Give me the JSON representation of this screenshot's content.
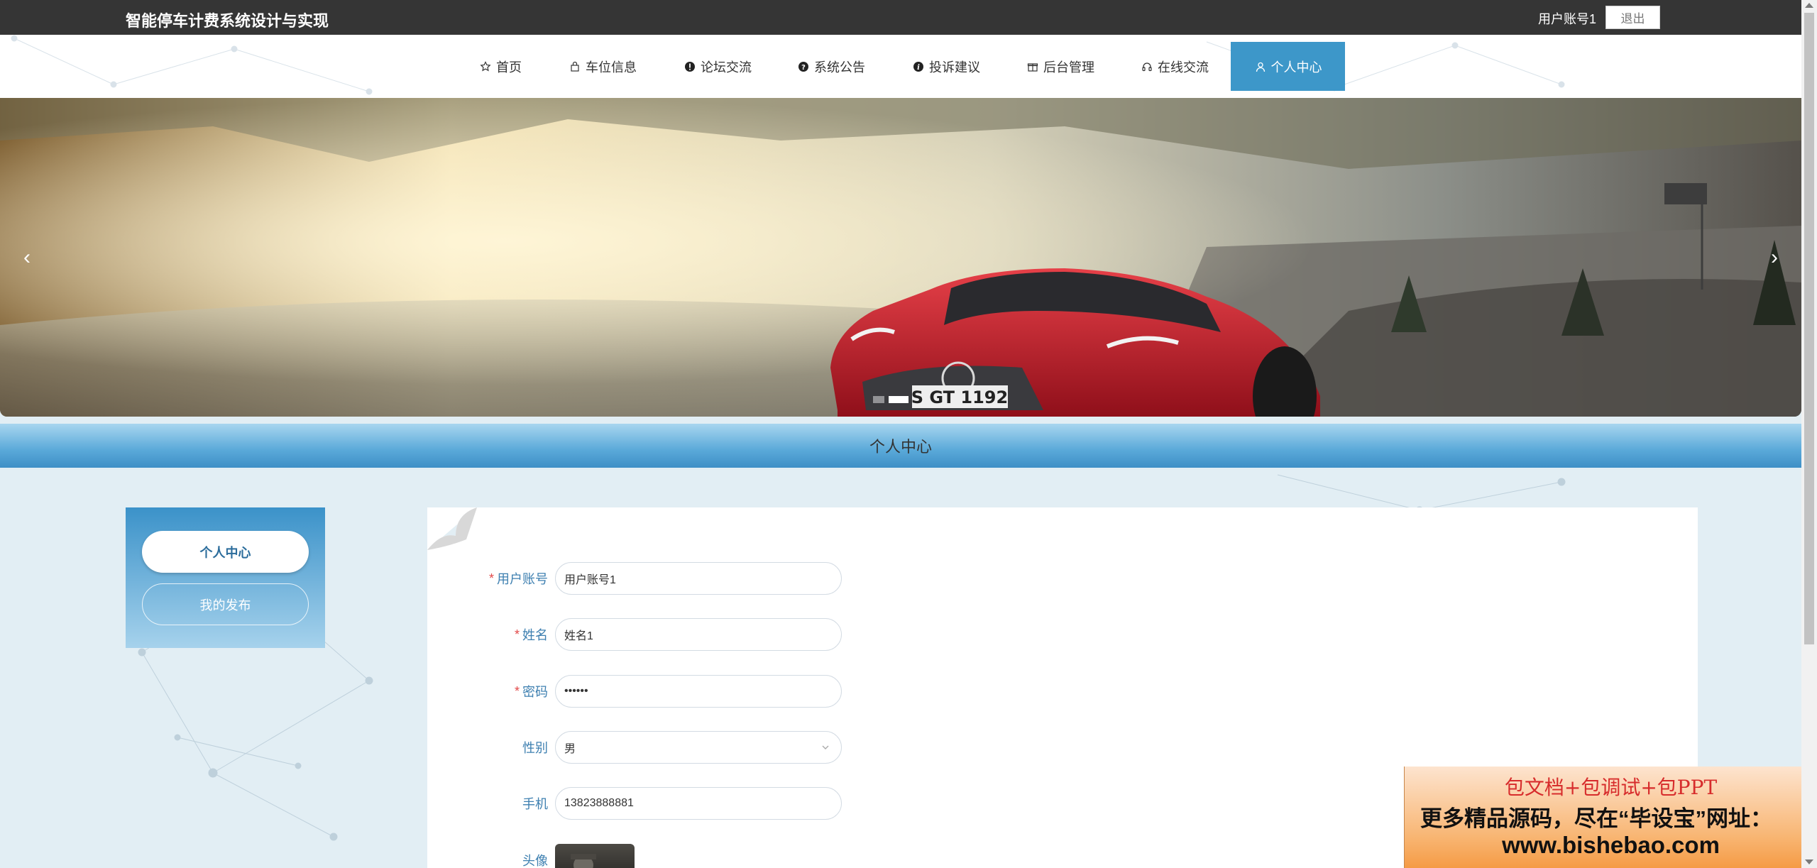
{
  "header": {
    "site_title": "智能停车计费系统设计与实现",
    "user_account": "用户账号1",
    "logout_label": "退出"
  },
  "nav": {
    "items": [
      {
        "label": "首页",
        "icon": "star-icon"
      },
      {
        "label": "车位信息",
        "icon": "bag-icon"
      },
      {
        "label": "论坛交流",
        "icon": "exclamation-circle-icon"
      },
      {
        "label": "系统公告",
        "icon": "question-circle-icon"
      },
      {
        "label": "投诉建议",
        "icon": "info-circle-icon"
      },
      {
        "label": "后台管理",
        "icon": "gift-box-icon"
      },
      {
        "label": "在线交流",
        "icon": "headset-icon"
      },
      {
        "label": "个人中心",
        "icon": "user-icon",
        "active": true
      }
    ]
  },
  "banner": {
    "plate_text": "S GT 1192",
    "slide_count": 2,
    "active_slide": 2
  },
  "section": {
    "title": "个人中心"
  },
  "sidebar": {
    "items": [
      {
        "label": "个人中心",
        "active": true
      },
      {
        "label": "我的发布",
        "active": false
      }
    ]
  },
  "form": {
    "fields": [
      {
        "label": "用户账号",
        "required": true,
        "value": "用户账号1"
      },
      {
        "label": "姓名",
        "required": true,
        "value": "姓名1"
      },
      {
        "label": "密码",
        "required": true,
        "value": "••••••"
      },
      {
        "label": "性别",
        "required": false,
        "value": "男"
      },
      {
        "label": "手机",
        "required": false,
        "value": "13823888881"
      },
      {
        "label": "头像",
        "required": false
      }
    ]
  },
  "promo": {
    "line1": "包文档+包调试+包PPT",
    "line2": "更多精品源码，尽在“毕设宝”网址：",
    "line3": "www.bishebao.com"
  },
  "colors": {
    "topbar": "#353535",
    "accent": "#3d97c9",
    "label_blue": "#3d7fb0",
    "required_red": "#e24a4a",
    "page_bg": "#e2eef4"
  }
}
